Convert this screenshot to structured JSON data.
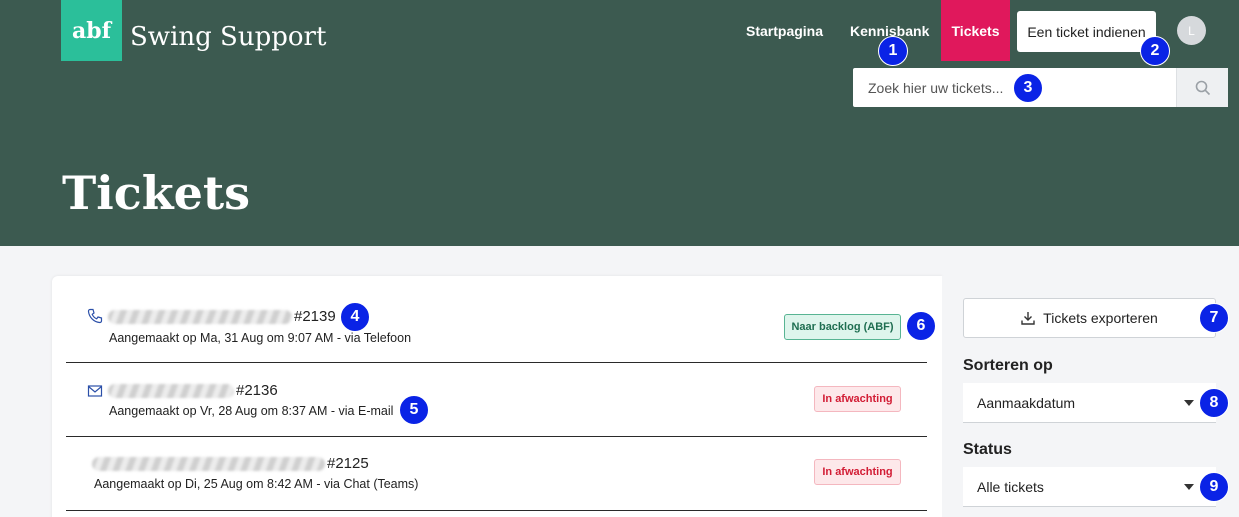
{
  "header": {
    "logo_text": "abf",
    "brand": "Swing Support",
    "nav": {
      "home": "Startpagina",
      "knowledge_base": "Kennisbank",
      "tickets": "Tickets"
    },
    "submit_button": "Een ticket indienen",
    "avatar_initial": "L",
    "search_placeholder": "Zoek hier uw tickets..."
  },
  "page_title": "Tickets",
  "tickets": [
    {
      "channel_icon": "phone-icon",
      "number": "#2139",
      "meta": "Aangemaakt op Ma, 31 Aug om 9:07 AM - via Telefoon",
      "status": "Naar backlog (ABF)"
    },
    {
      "channel_icon": "mail-icon",
      "number": "#2136",
      "meta": "Aangemaakt op Vr, 28 Aug om 8:37 AM - via E-mail",
      "status": "In afwachting"
    },
    {
      "channel_icon": "chat-icon",
      "number": "#2125",
      "meta": "Aangemaakt op Di, 25 Aug om 8:42 AM - via Chat (Teams)",
      "status": "In afwachting"
    }
  ],
  "sidebar": {
    "export_button": "Tickets exporteren",
    "sort_label": "Sorteren op",
    "sort_value": "Aanmaakdatum",
    "status_label": "Status",
    "status_value": "Alle tickets"
  },
  "markers": [
    "1",
    "2",
    "3",
    "4",
    "5",
    "6",
    "7",
    "8",
    "9"
  ],
  "colors": {
    "header_bg": "#3c5a50",
    "accent": "#e0185c",
    "logo_bg": "#2bbf9a",
    "marker": "#0a23e6"
  }
}
